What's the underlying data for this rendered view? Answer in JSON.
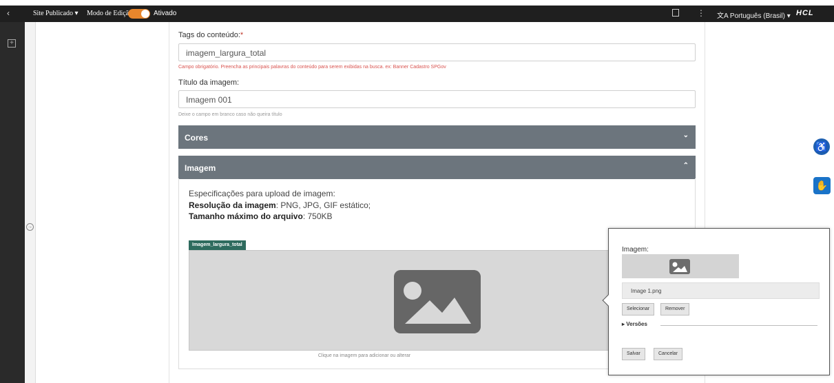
{
  "topbar": {
    "back_icon": "‹",
    "site_status": "Site Publicado ▾",
    "mode_label": "Modo de Edição:",
    "mode_state": "Ativado",
    "kebab": "⋮",
    "language": "文A  Português (Brasil)  ▾",
    "brand": "HCL"
  },
  "form": {
    "tags_label": "Tags do conteúdo:",
    "tags_required": "*",
    "tags_value": "imagem_largura_total",
    "tags_error": "Campo obrigatório. Preencha as principais palavras do conteúdo para serem exibidas na busca. ex: Banner Cadastro SPGov",
    "title_label": "Título da imagem:",
    "title_value": "Imagem 001",
    "title_hint": "Deixe o campo em branco caso não queira título"
  },
  "accordions": {
    "cores_label": "Cores",
    "cores_chevron": "⌄",
    "imagem_label": "Imagem",
    "imagem_chevron": "⌃"
  },
  "imagem_section": {
    "spec_intro": "Especificações para upload de imagem:",
    "res_label": "Resolução da imagem",
    "res_value": ": PNG, JPG, GIF estático;",
    "size_label": "Tamanho máximo do arquivo",
    "size_value": ": 750KB",
    "image_tag": "Imagem_largura_total",
    "dropzone_caption": "Clique na imagem para adicionar ou alterar"
  },
  "popup": {
    "label": "Imagem:",
    "filename": "Image 1.png",
    "select_btn": "Selecionar",
    "remove_btn": "Remover",
    "versions": "▸ Versões",
    "save_btn": "Salvar",
    "cancel_btn": "Cancelar"
  },
  "side_icons": {
    "accessibility": "♿",
    "libras": "✋"
  },
  "colors": {
    "accent": "#e8862c",
    "accordion": "#6c757d",
    "tag": "#2e6b5e",
    "side_icon": "#1a73c8"
  }
}
